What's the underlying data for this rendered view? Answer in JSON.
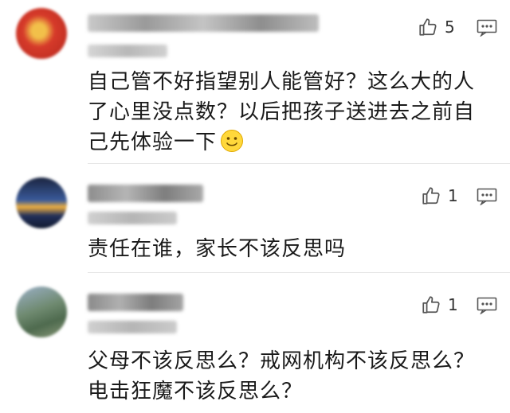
{
  "comments": [
    {
      "text": "自己管不好指望别人能管好？这么大的人了心里没点数？以后把孩子送进去之前自己先体验一下",
      "likes": "5",
      "avatar_color": "#d23a2a",
      "emoji": "smiley"
    },
    {
      "text": "责任在谁，家长不该反思吗",
      "likes": "1",
      "avatar_color": "#2b3f6a"
    },
    {
      "text": "父母不该反思么？戒网机构不该反思么？电击狂魔不该反思么？",
      "likes": "1",
      "avatar_color": "#7a8f78"
    }
  ],
  "icons": {
    "like": "thumbs-up-icon",
    "reply": "comment-icon"
  }
}
